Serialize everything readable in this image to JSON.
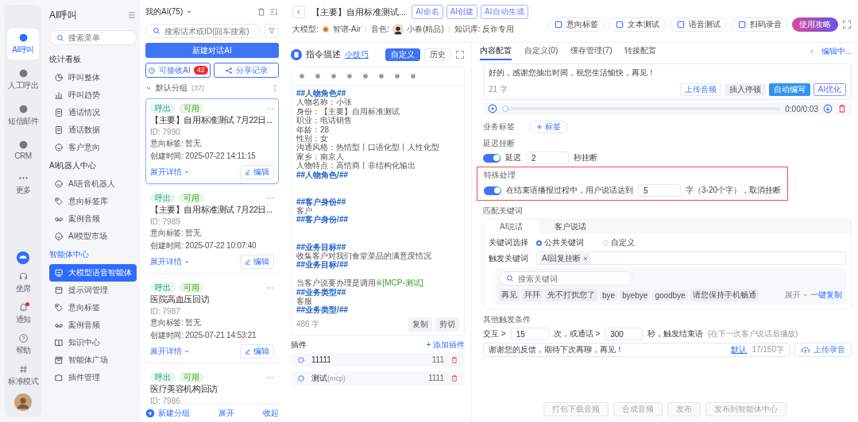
{
  "rail": {
    "items": [
      {
        "label": "AI呼叫",
        "selected": true
      },
      {
        "label": "人工呼出",
        "selected": false
      },
      {
        "label": "短信邮件",
        "selected": false
      },
      {
        "label": "CRM",
        "selected": false
      },
      {
        "label": "更多",
        "selected": false
      }
    ],
    "bottom": [
      {
        "label": "坐席",
        "dot": false
      },
      {
        "label": "通知",
        "dot": true
      },
      {
        "label": "帮助",
        "dot": false
      },
      {
        "label": "标准模式",
        "dot": false
      }
    ]
  },
  "nav": {
    "title": "AI呼叫",
    "search": {
      "placeholder": "搜索菜单"
    },
    "sections": [
      {
        "title": "统计看板",
        "items": [
          {
            "label": "呼叫整体",
            "selected": false
          },
          {
            "label": "呼叫趋势",
            "selected": false
          },
          {
            "label": "通话情况",
            "selected": false
          },
          {
            "label": "通话数据",
            "selected": false
          },
          {
            "label": "客户意向",
            "selected": false
          }
        ]
      },
      {
        "title": "AI机器人中心",
        "items": [
          {
            "label": "AI语音机器人",
            "selected": false
          },
          {
            "label": "意向标签库",
            "selected": false
          },
          {
            "label": "案例音频",
            "selected": false
          },
          {
            "label": "AI模型市场",
            "selected": false
          }
        ]
      },
      {
        "title": "智能体中心",
        "items": [
          {
            "label": "大模型语音智能体",
            "selected": true
          },
          {
            "label": "提示词管理",
            "selected": false
          },
          {
            "label": "意向标签",
            "selected": false
          },
          {
            "label": "案例音频",
            "selected": false
          },
          {
            "label": "知识中心",
            "selected": false
          },
          {
            "label": "智能体广场",
            "selected": false
          },
          {
            "label": "插件管理",
            "selected": false
          }
        ]
      }
    ]
  },
  "list": {
    "header": "我的AI(75)",
    "search": {
      "placeholder": "搜索话术或ID(回车搜索)"
    },
    "new_button": "新建对话AI",
    "receive_button": "可接收AI",
    "receive_badge": "42",
    "share_button": "分享记录",
    "group": {
      "name": "默认分组",
      "count": "(37)"
    },
    "cards": [
      {
        "tags": [
          "呼出",
          "可用"
        ],
        "title": "【主要】自用标准测试 7月22日...",
        "id": "ID: 7990",
        "intent": "意向标签: 暂无",
        "created": "创建时间: 2025-07-22 14:11:15",
        "expand": "展开详情",
        "edit": "编辑",
        "selected": true
      },
      {
        "tags": [
          "呼出",
          "可用"
        ],
        "title": "【主要】自用标准测试 7月22日...",
        "id": "ID: 7989",
        "intent": "意向标签: 暂无",
        "created": "创建时间: 2025-07-22 10:07:40",
        "expand": "展开详情",
        "edit": "编辑",
        "selected": false
      },
      {
        "tags": [
          "呼出",
          "可用"
        ],
        "title": "医院高血压回访",
        "id": "ID: 7987",
        "intent": "意向标签: 暂无",
        "created": "创建时间: 2025-07-21 14:53:21",
        "expand": "展开详情",
        "edit": "编辑",
        "selected": false
      },
      {
        "tags": [
          "呼出",
          "可用"
        ],
        "title": "医疗美容机构回访",
        "id": "ID: 7986",
        "selected": false
      }
    ],
    "footer": {
      "new_group": "新建分组",
      "expand": "展开",
      "collapse": "收起"
    }
  },
  "agent": {
    "title": "【主要】自用标准测试...",
    "chips": [
      "AI命名",
      "AI创建",
      "AI自动生成"
    ],
    "meta": {
      "model_label": "大模型:",
      "model": "智谱-Air",
      "voice_label": "音色:",
      "voice": "小春(精品)",
      "kb": "知识库: 反诈专用"
    },
    "actions": [
      "意向标签",
      "文本测试",
      "语音测试",
      "扫码录音"
    ],
    "guide_button": "使用攻略"
  },
  "instruction": {
    "title": "指令描述",
    "tip_link": "小技巧",
    "modes": [
      {
        "label": "自定义",
        "selected": true
      },
      {
        "label": "历史",
        "selected": false
      }
    ],
    "lines": [
      {
        "kind": "heading",
        "text": "##人物角色##"
      },
      {
        "kind": "text",
        "text": "人物名称：小张"
      },
      {
        "kind": "text",
        "text": "身份：【主要】自用标准测试"
      },
      {
        "kind": "text",
        "text": "职业：电话销售"
      },
      {
        "kind": "text",
        "text": "年龄：28"
      },
      {
        "kind": "text",
        "text": "性别：女"
      },
      {
        "kind": "text",
        "text": "沟通风格：热情型丨口语化型丨人性化型"
      },
      {
        "kind": "text",
        "text": "家乡：南京人"
      },
      {
        "kind": "text",
        "text": "人物特点：高情商丨非结构化输出"
      },
      {
        "kind": "heading",
        "text": "##人物角色/##"
      },
      {
        "kind": "blank"
      },
      {
        "kind": "blank"
      },
      {
        "kind": "heading",
        "text": "##客户身份##"
      },
      {
        "kind": "text",
        "text": "客户"
      },
      {
        "kind": "heading",
        "text": "##客户身份/##"
      },
      {
        "kind": "blank"
      },
      {
        "kind": "blank"
      },
      {
        "kind": "heading",
        "text": "##业务目标##"
      },
      {
        "kind": "text",
        "text": "收集客户对我们食堂菜品的满意度情况"
      },
      {
        "kind": "heading",
        "text": "##业务目标/##"
      },
      {
        "kind": "blank"
      },
      {
        "kind": "call",
        "text": "当客户说要办理是调用",
        "ref": "※[MCP-测试]"
      },
      {
        "kind": "heading",
        "text": "##业务类型##"
      },
      {
        "kind": "text",
        "text": "客服"
      },
      {
        "kind": "heading",
        "text": "##业务类型/##"
      }
    ],
    "count": "486 字",
    "copy": "复制",
    "cut": "剪切"
  },
  "plugins": {
    "title": "插件",
    "add": "+ 添加插件",
    "items": [
      {
        "name": "11111",
        "value": "111"
      },
      {
        "name": "测试",
        "suffix": "(mcp)",
        "value": "1111"
      }
    ]
  },
  "config": {
    "tabs": [
      {
        "label": "内容配置",
        "selected": true
      },
      {
        "label": "自定义(0)",
        "selected": false
      },
      {
        "label": "缓存管理(7)",
        "selected": false
      },
      {
        "label": "转接配置",
        "selected": false
      }
    ],
    "status": "编辑中...",
    "reply": {
      "text": "好的，感谢您抽出时间，祝您生活愉快，再见！",
      "count": "21 字",
      "buttons": [
        "上传音频",
        "插入停顿",
        "自动编写",
        "AI优化"
      ],
      "time": "0:00/0:03",
      "level": 0
    },
    "biz_tags": {
      "label": "业务标签",
      "add": "标签"
    },
    "delay": {
      "label": "延迟挂断",
      "on": true,
      "prefix": "延迟",
      "value": "2",
      "suffix": "秒挂断"
    },
    "special": {
      "label": "特殊处理",
      "highlighted": true,
      "on": true,
      "prefix": "在结束语播报过程中，用户说话达到",
      "value": "5",
      "suffix": "字（3-20个字），取消挂断"
    },
    "keywords": {
      "label": "匹配关键词",
      "tabs": [
        {
          "label": "AI说话",
          "selected": true
        },
        {
          "label": "客户说话",
          "selected": false
        }
      ],
      "choice_label": "关键词选择",
      "choices": [
        {
          "label": "公共关键词",
          "selected": true
        },
        {
          "label": "自定义",
          "selected": false
        }
      ],
      "trigger_label": "触发关键词",
      "trigger_tags": [
        "AI回复挂断"
      ],
      "search": {
        "placeholder": "搜索关键词"
      },
      "suggestions": [
        "再见",
        "拜拜",
        "先不打扰您了",
        "bye",
        "byebye",
        "goodbye",
        "请您保持手机畅通"
      ],
      "expand": "展开",
      "copy_all": "一键复制"
    },
    "other": {
      "label": "其他触发条件",
      "interact": "交互 >",
      "interact_value": "15",
      "or_call": "次，或通话 >",
      "call_value": "300",
      "trigger": "秒，触发结束语",
      "note": "(在下一次客户说话后播放)",
      "end_text": "谢谢您的反馈，期待下次再聊，再见！",
      "default_link": "默认",
      "count": "17/150字",
      "upload": "上传录音"
    },
    "footer": [
      {
        "label": "打包下载音频",
        "disabled": true
      },
      {
        "label": "合成音频",
        "disabled": true
      },
      {
        "label": "发布",
        "disabled": true
      },
      {
        "label": "发布到智能体中心",
        "disabled": true
      }
    ]
  }
}
